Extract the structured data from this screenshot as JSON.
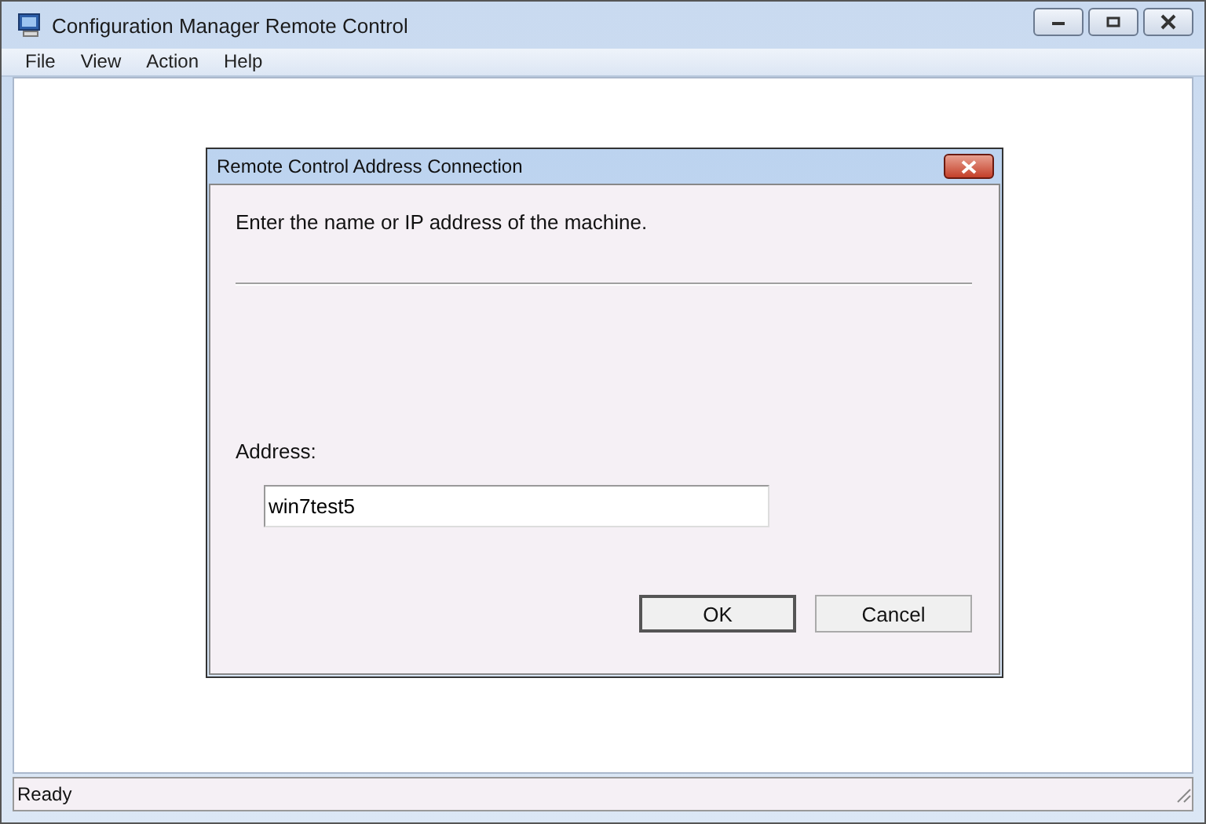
{
  "window": {
    "title": "Configuration Manager Remote Control"
  },
  "menu": [
    "File",
    "View",
    "Action",
    "Help"
  ],
  "dialog": {
    "title": "Remote Control Address Connection",
    "instruction": "Enter the name or IP address of the machine.",
    "address_label": "Address:",
    "address_value": "win7test5",
    "buttons": [
      {
        "label": "OK",
        "default": true
      },
      {
        "label": "Cancel",
        "default": false
      }
    ]
  },
  "status_bar": "Ready"
}
